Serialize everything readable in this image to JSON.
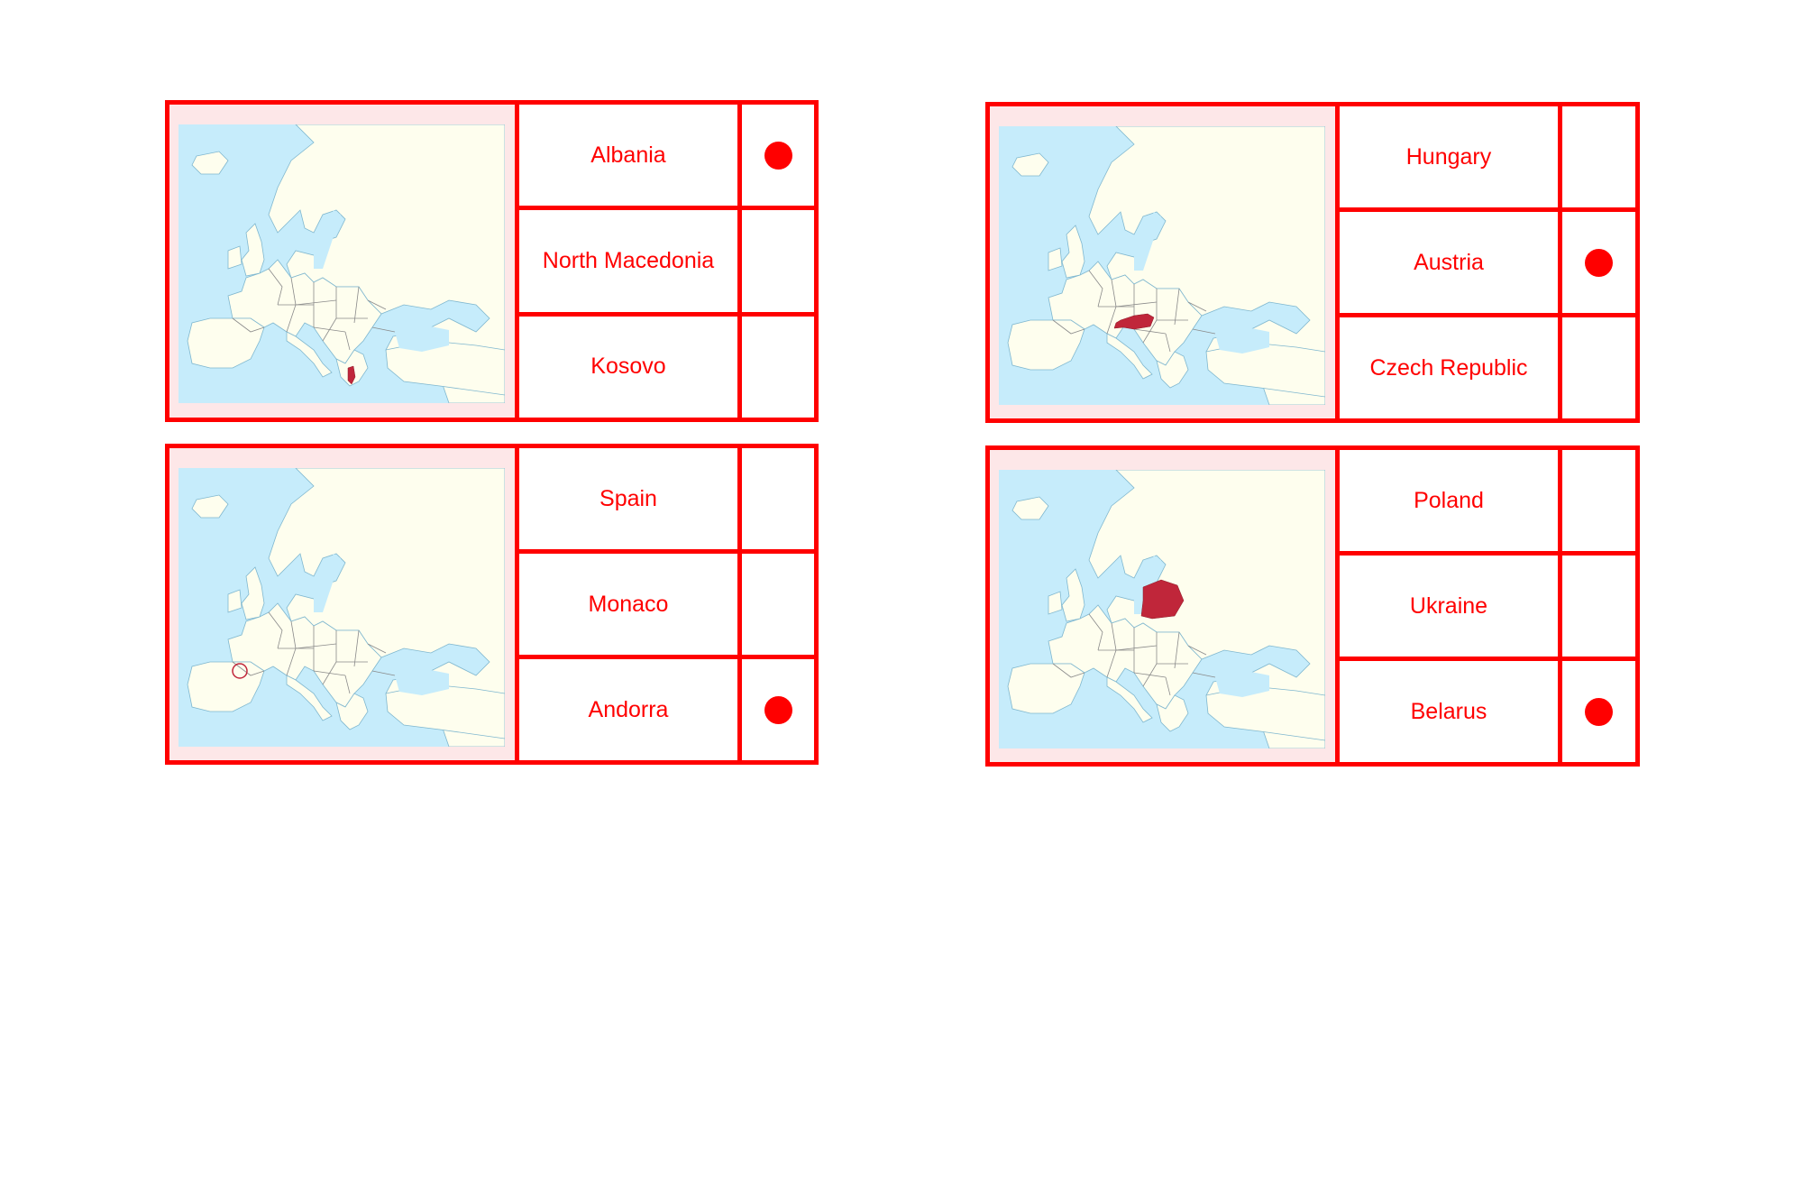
{
  "colors": {
    "accent": "#ff0000",
    "map_background": "#fde7e8",
    "sea": "#c6ecfb",
    "land": "#fefeee",
    "highlight": "#c0263a"
  },
  "cards": [
    {
      "highlighted_country": "Albania",
      "options": [
        {
          "label": "Albania",
          "marked": true
        },
        {
          "label": "North Macedonia",
          "marked": false
        },
        {
          "label": "Kosovo",
          "marked": false
        }
      ]
    },
    {
      "highlighted_country": "Austria",
      "options": [
        {
          "label": "Hungary",
          "marked": false
        },
        {
          "label": "Austria",
          "marked": true
        },
        {
          "label": "Czech Republic",
          "marked": false
        }
      ]
    },
    {
      "highlighted_country": "Andorra",
      "options": [
        {
          "label": "Spain",
          "marked": false
        },
        {
          "label": "Monaco",
          "marked": false
        },
        {
          "label": "Andorra",
          "marked": true
        }
      ]
    },
    {
      "highlighted_country": "Belarus",
      "options": [
        {
          "label": "Poland",
          "marked": false
        },
        {
          "label": "Ukraine",
          "marked": false
        },
        {
          "label": "Belarus",
          "marked": true
        }
      ]
    }
  ]
}
